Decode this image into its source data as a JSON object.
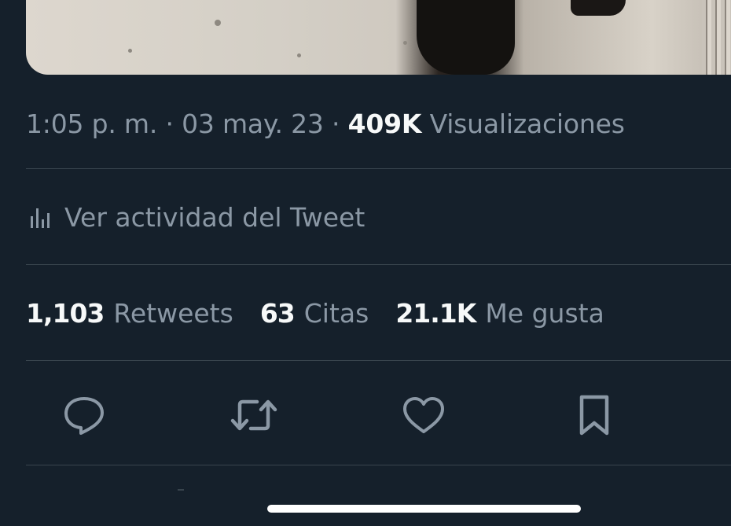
{
  "tweet": {
    "time": "1:05 p. m.",
    "date": "03 may. 23",
    "separator": "·",
    "views_count": "409K",
    "views_label": "Visualizaciones",
    "activity_label": "Ver actividad del Tweet",
    "stats": [
      {
        "count": "1,103",
        "label": "Retweets"
      },
      {
        "count": "63",
        "label": "Citas"
      },
      {
        "count": "21.1K",
        "label": "Me gusta"
      }
    ]
  },
  "icons": {
    "activity": "bar-chart-icon",
    "reply": "reply-icon",
    "retweet": "retweet-icon",
    "like": "heart-icon",
    "bookmark": "bookmark-icon"
  },
  "colors": {
    "background": "#15202b",
    "text_primary": "#f7f9f9",
    "text_secondary": "#8b98a5",
    "divider": "#38444d"
  }
}
